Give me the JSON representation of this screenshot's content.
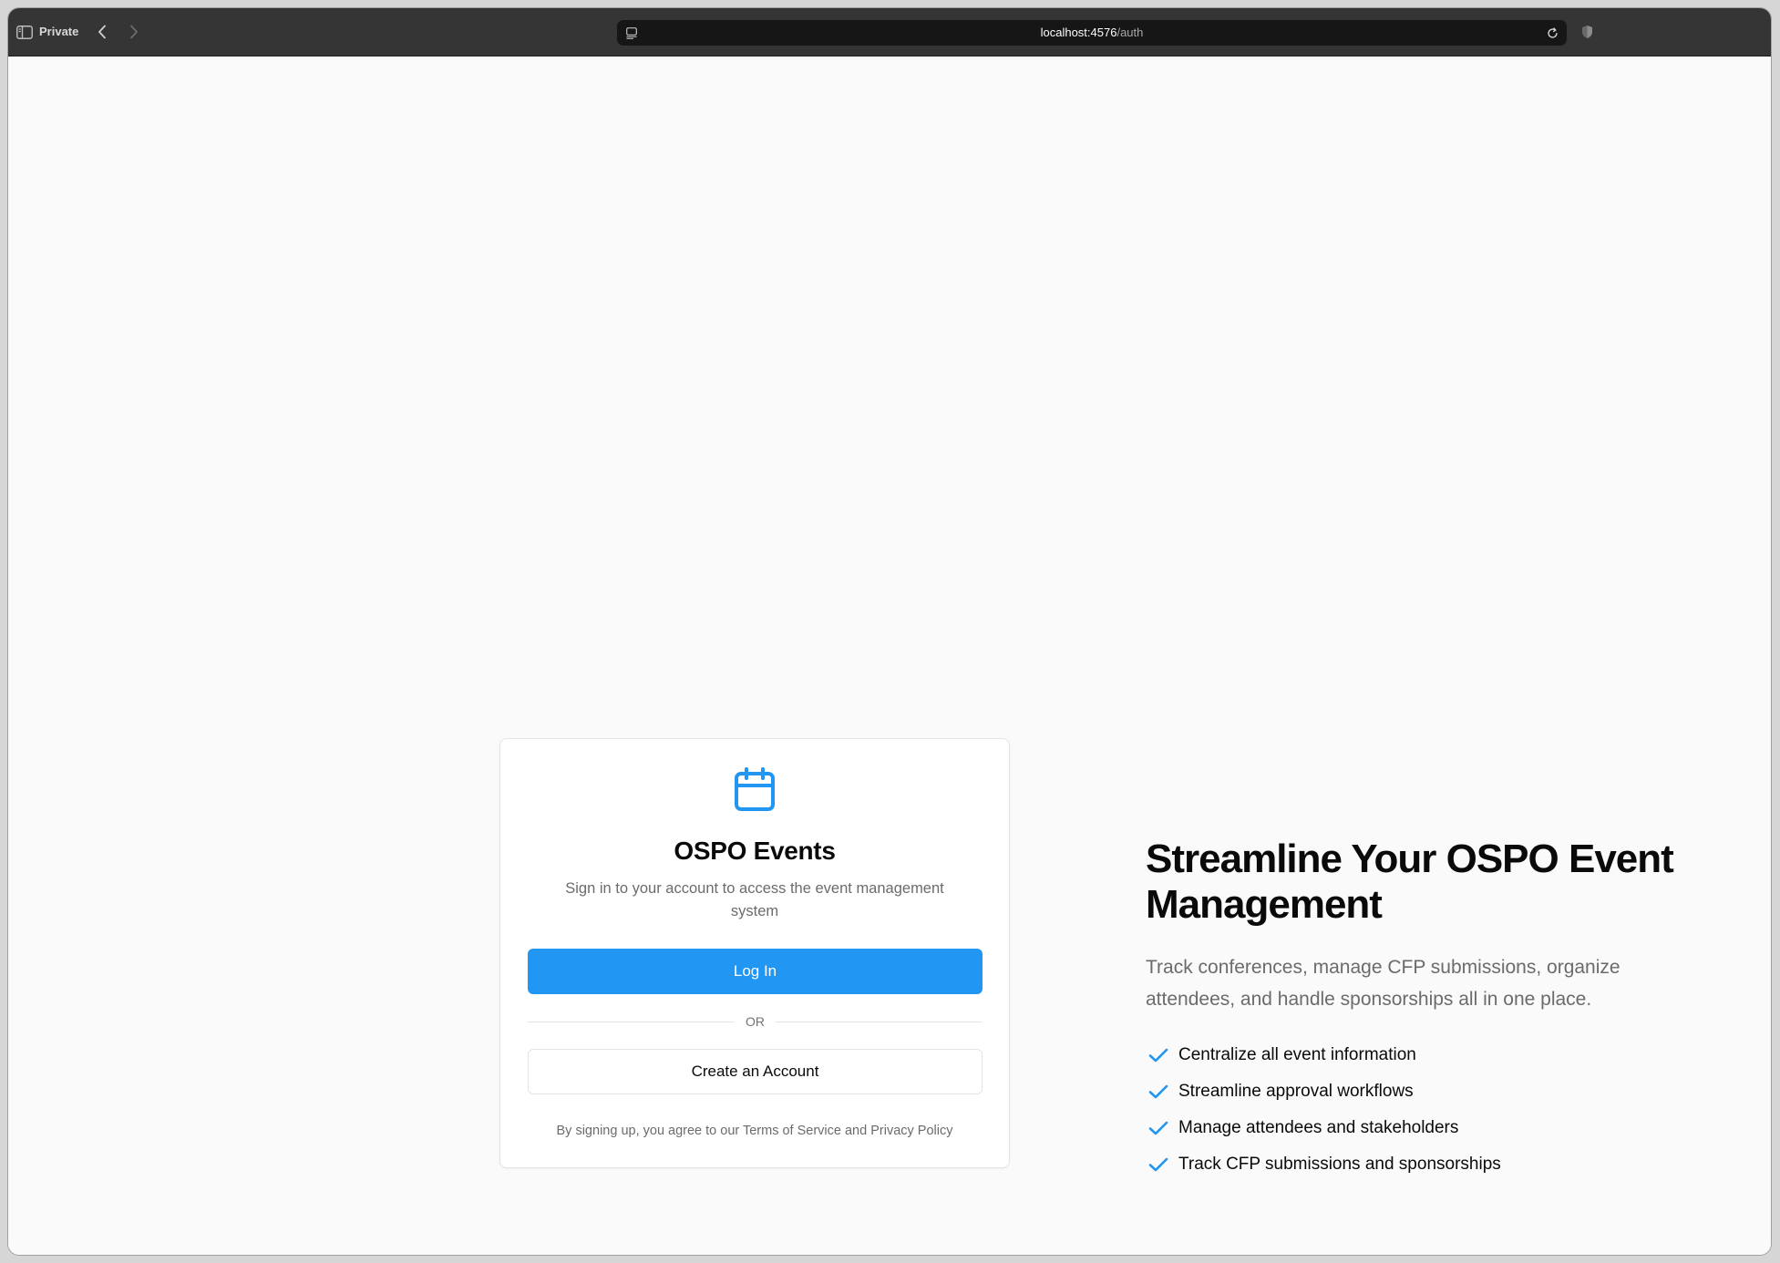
{
  "browser": {
    "private_label": "Private",
    "url_host": "localhost:4576",
    "url_path": "/auth"
  },
  "colors": {
    "accent": "#2196f3",
    "text_primary": "#0a0a0a",
    "text_muted": "#6b6b6b",
    "card_border": "#e4e4e7"
  },
  "card": {
    "icon": "calendar-icon",
    "title": "OSPO Events",
    "subtitle": "Sign in to your account to access the event management system",
    "login_label": "Log In",
    "divider_label": "OR",
    "create_label": "Create an Account",
    "footer": "By signing up, you agree to our Terms of Service and Privacy Policy"
  },
  "hero": {
    "title": "Streamline Your OSPO Event Management",
    "description": "Track conferences, manage CFP submissions, organize attendees, and handle sponsorships all in one place.",
    "feature_icon": "check-icon",
    "features": [
      "Centralize all event information",
      "Streamline approval workflows",
      "Manage attendees and stakeholders",
      "Track CFP submissions and sponsorships"
    ]
  }
}
